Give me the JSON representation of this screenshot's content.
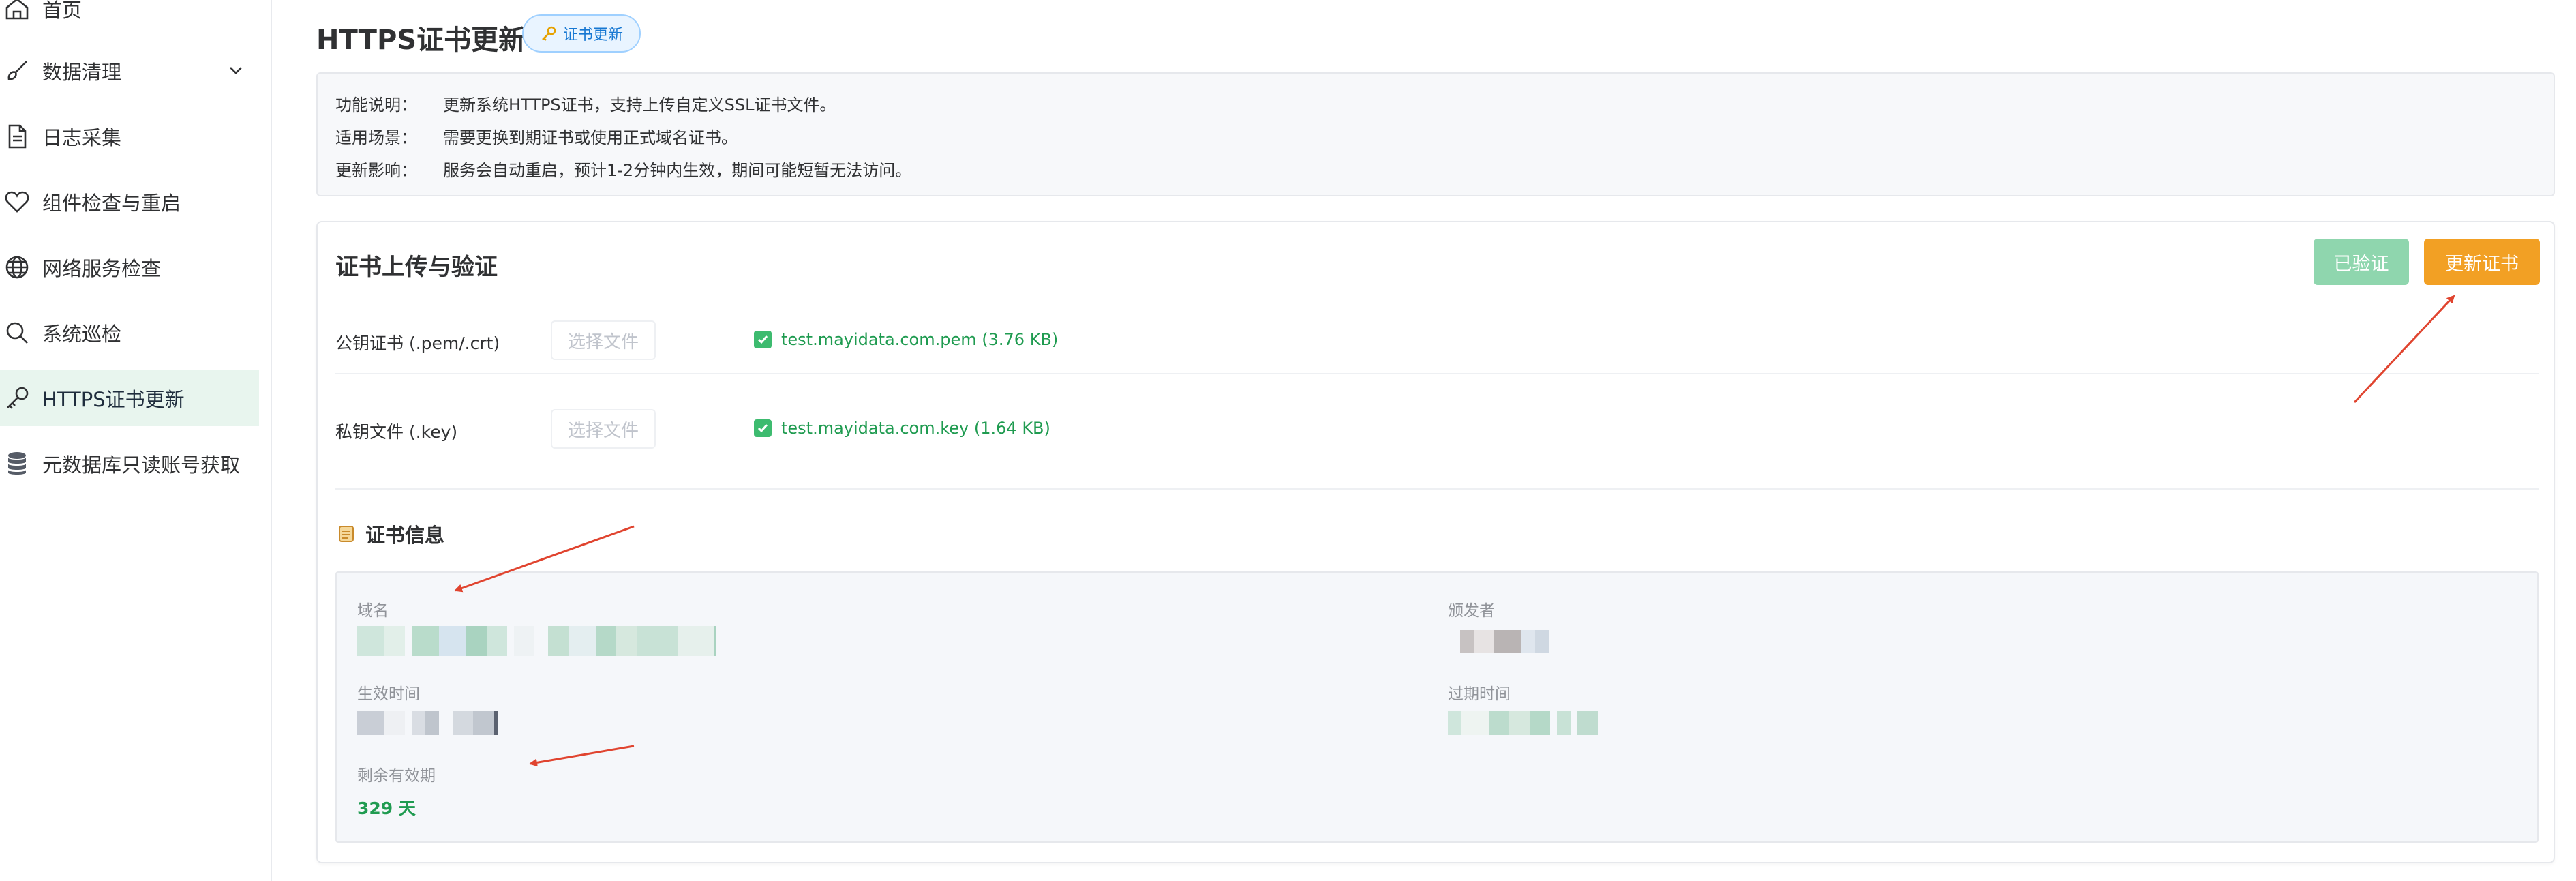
{
  "sidebar": {
    "items": [
      {
        "label": "首页",
        "icon": "home-icon"
      },
      {
        "label": "数据清理",
        "icon": "brush-icon",
        "has_submenu": true
      },
      {
        "label": "日志采集",
        "icon": "document-icon"
      },
      {
        "label": "组件检查与重启",
        "icon": "heart-icon"
      },
      {
        "label": "网络服务检查",
        "icon": "globe-icon"
      },
      {
        "label": "系统巡检",
        "icon": "search-icon"
      },
      {
        "label": "HTTPS证书更新",
        "icon": "key-icon",
        "active": true
      },
      {
        "label": "元数据库只读账号获取",
        "icon": "database-icon"
      }
    ]
  },
  "header": {
    "title": "HTTPS证书更新",
    "tag": "证书更新"
  },
  "info": {
    "rows": [
      {
        "key": "功能说明：",
        "value": "更新系统HTTPS证书，支持上传自定义SSL证书文件。"
      },
      {
        "key": "适用场景：",
        "value": "需要更换到期证书或使用正式域名证书。"
      },
      {
        "key": "更新影响：",
        "value": "服务会自动重启，预计1-2分钟内生效，期间可能短暂无法访问。"
      }
    ]
  },
  "upload": {
    "title": "证书上传与验证",
    "verified_label": "已验证",
    "update_label": "更新证书",
    "public_cert": {
      "label": "公钥证书 (.pem/.crt)",
      "button": "选择文件",
      "file": "test.mayidata.com.pem (3.76 KB)"
    },
    "private_key": {
      "label": "私钥文件 (.key)",
      "button": "选择文件",
      "file": "test.mayidata.com.key (1.64 KB)"
    }
  },
  "cert_info": {
    "title": "证书信息",
    "domain_label": "域名",
    "issuer_label": "颁发者",
    "valid_from_label": "生效时间",
    "expires_label": "过期时间",
    "remaining_label": "剩余有效期",
    "remaining_value": "329 天"
  },
  "colors": {
    "accent_green": "#1f9b50",
    "verified_button": "#8fd6ae",
    "update_button": "#f2a024",
    "annotation_arrow": "#e0442f",
    "active_nav_bg": "#e8f5ee"
  }
}
